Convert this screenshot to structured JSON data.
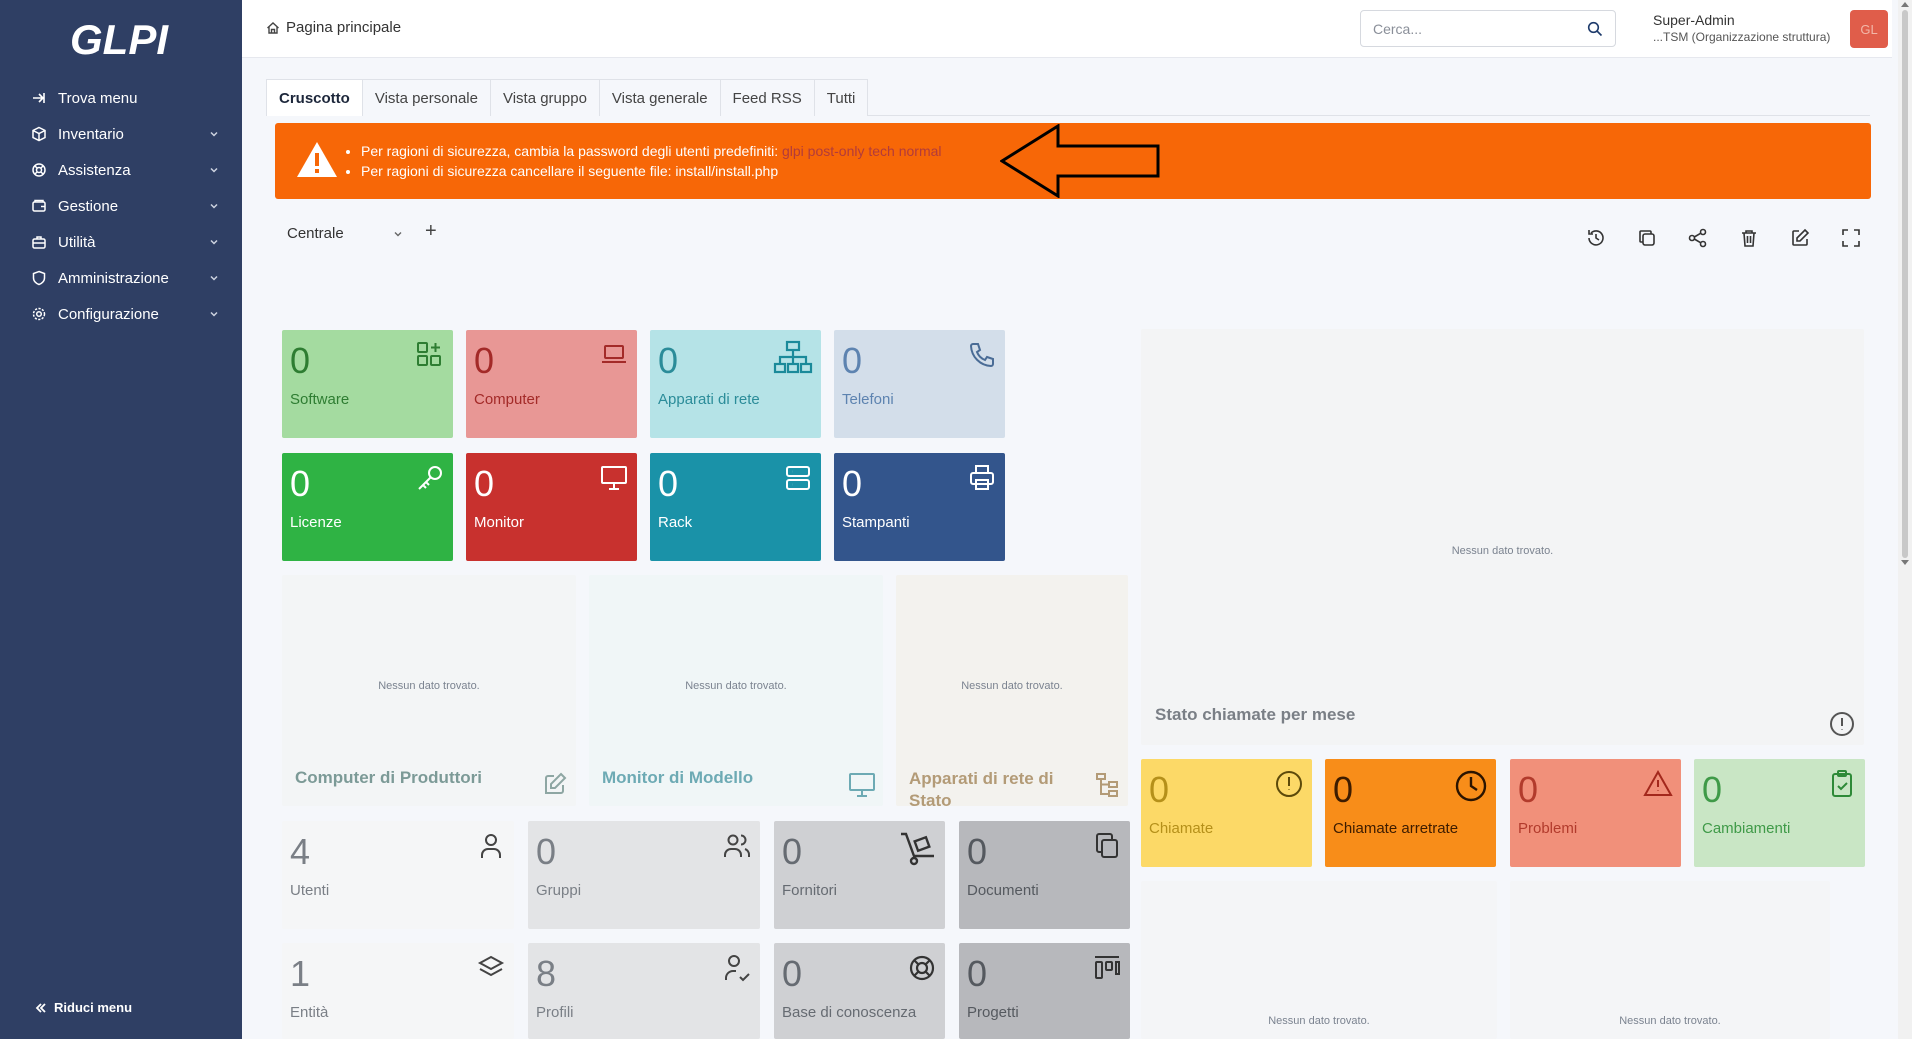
{
  "app": {
    "logo_text": "GLPI",
    "collapse_label": "Riduci menu"
  },
  "sidebar": {
    "items": [
      {
        "label": "Trova menu",
        "icon": "arrow-right-icon",
        "has_chevron": false
      },
      {
        "label": "Inventario",
        "icon": "cube-icon",
        "has_chevron": true
      },
      {
        "label": "Assistenza",
        "icon": "lifebuoy-icon",
        "has_chevron": true
      },
      {
        "label": "Gestione",
        "icon": "wallet-icon",
        "has_chevron": true
      },
      {
        "label": "Utilità",
        "icon": "briefcase-icon",
        "has_chevron": true
      },
      {
        "label": "Amministrazione",
        "icon": "shield-icon",
        "has_chevron": true
      },
      {
        "label": "Configurazione",
        "icon": "gear-icon",
        "has_chevron": true
      }
    ]
  },
  "header": {
    "breadcrumb": "Pagina principale",
    "search_placeholder": "Cerca...",
    "user_name": "Super-Admin",
    "user_entity": "...TSM (Organizzazione struttura)",
    "avatar_initials": "GL"
  },
  "tabs": [
    {
      "label": "Cruscotto",
      "active": true
    },
    {
      "label": "Vista personale",
      "active": false
    },
    {
      "label": "Vista gruppo",
      "active": false
    },
    {
      "label": "Vista generale",
      "active": false
    },
    {
      "label": "Feed RSS",
      "active": false
    },
    {
      "label": "Tutti",
      "active": false
    }
  ],
  "alert": {
    "line1_text": "Per ragioni di sicurezza, cambia la password degli utenti predefiniti: ",
    "line1_links": "glpi post-only tech normal",
    "line2_text": "Per ragioni di sicurezza cancellare il seguente file: install/install.php"
  },
  "dashboard": {
    "selected": "Centrale",
    "add_label": "+"
  },
  "cards": {
    "software": {
      "value": "0",
      "label": "Software"
    },
    "computer": {
      "value": "0",
      "label": "Computer"
    },
    "network": {
      "value": "0",
      "label": "Apparati di rete"
    },
    "phones": {
      "value": "0",
      "label": "Telefoni"
    },
    "licenses": {
      "value": "0",
      "label": "Licenze"
    },
    "monitor": {
      "value": "0",
      "label": "Monitor"
    },
    "rack": {
      "value": "0",
      "label": "Rack"
    },
    "printers": {
      "value": "0",
      "label": "Stampanti"
    },
    "users": {
      "value": "4",
      "label": "Utenti"
    },
    "groups": {
      "value": "0",
      "label": "Gruppi"
    },
    "suppliers": {
      "value": "0",
      "label": "Fornitori"
    },
    "documents": {
      "value": "0",
      "label": "Documenti"
    },
    "entities": {
      "value": "1",
      "label": "Entità"
    },
    "profiles": {
      "value": "8",
      "label": "Profili"
    },
    "knowledge": {
      "value": "0",
      "label": "Base di conoscenza"
    },
    "projects": {
      "value": "0",
      "label": "Progetti"
    },
    "tickets": {
      "value": "0",
      "label": "Chiamate"
    },
    "late_tickets": {
      "value": "0",
      "label": "Chiamate arretrate"
    },
    "problems": {
      "value": "0",
      "label": "Problemi"
    },
    "changes": {
      "value": "0",
      "label": "Cambiamenti"
    }
  },
  "widgets": {
    "nodata": "Nessun dato trovato.",
    "computers_by_manufacturer": "Computer di Produttori",
    "monitors_by_model": "Monitor di Modello",
    "network_by_status": "Apparati di rete di Stato",
    "tickets_by_month": "Stato chiamate per mese"
  },
  "colors": {
    "sidebar": "#2f3f64",
    "alert": "#f76707",
    "software": "#a4dba0",
    "computer": "#e89795",
    "network": "#b5e3e7",
    "phones": "#d3deea",
    "licenses": "#2fb344",
    "monitor": "#c8312e",
    "rack": "#1a92a8",
    "printers": "#33558c"
  }
}
